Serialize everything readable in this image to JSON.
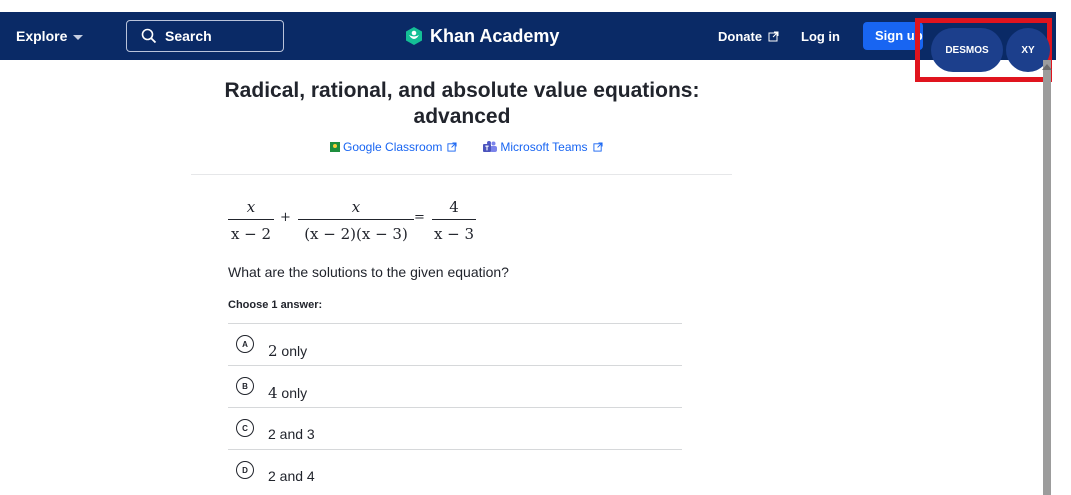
{
  "nav": {
    "explore_label": "Explore",
    "search_label": "Search",
    "brand_name": "Khan Academy",
    "donate_label": "Donate",
    "login_label": "Log in",
    "signup_label": "Sign up"
  },
  "tools": {
    "desmos_label": "DESMOS",
    "xy_label": "XY",
    "highlight_color": "#e0141e"
  },
  "page": {
    "title": "Radical, rational, and absolute value equations: advanced",
    "share": {
      "google_classroom": "Google Classroom",
      "microsoft_teams": "Microsoft Teams"
    }
  },
  "problem": {
    "equation": {
      "term1": {
        "num": "x",
        "den": "x − 2"
      },
      "plus": "+",
      "term2": {
        "num": "x",
        "den": "(x − 2)(x − 3)"
      },
      "equals": "=",
      "term3": {
        "num": "4",
        "den": "x − 3"
      }
    },
    "question": "What are the solutions to the given equation?",
    "choose_label": "Choose 1 answer:",
    "answers": [
      {
        "letter": "A",
        "value": "2",
        "suffix": " only"
      },
      {
        "letter": "B",
        "value": "4",
        "suffix": " only"
      },
      {
        "letter": "C",
        "value": "2 and 3",
        "suffix": ""
      },
      {
        "letter": "D",
        "value": "2 and 4",
        "suffix": ""
      }
    ]
  },
  "colors": {
    "nav_bg": "#0a2a66",
    "signup_bg": "#1865f2",
    "tool_button_bg": "#1c3f8c",
    "link": "#1865f2"
  },
  "icons": [
    "search-icon",
    "khan-academy-logo-icon",
    "external-link-icon",
    "google-classroom-icon",
    "microsoft-teams-icon"
  ]
}
